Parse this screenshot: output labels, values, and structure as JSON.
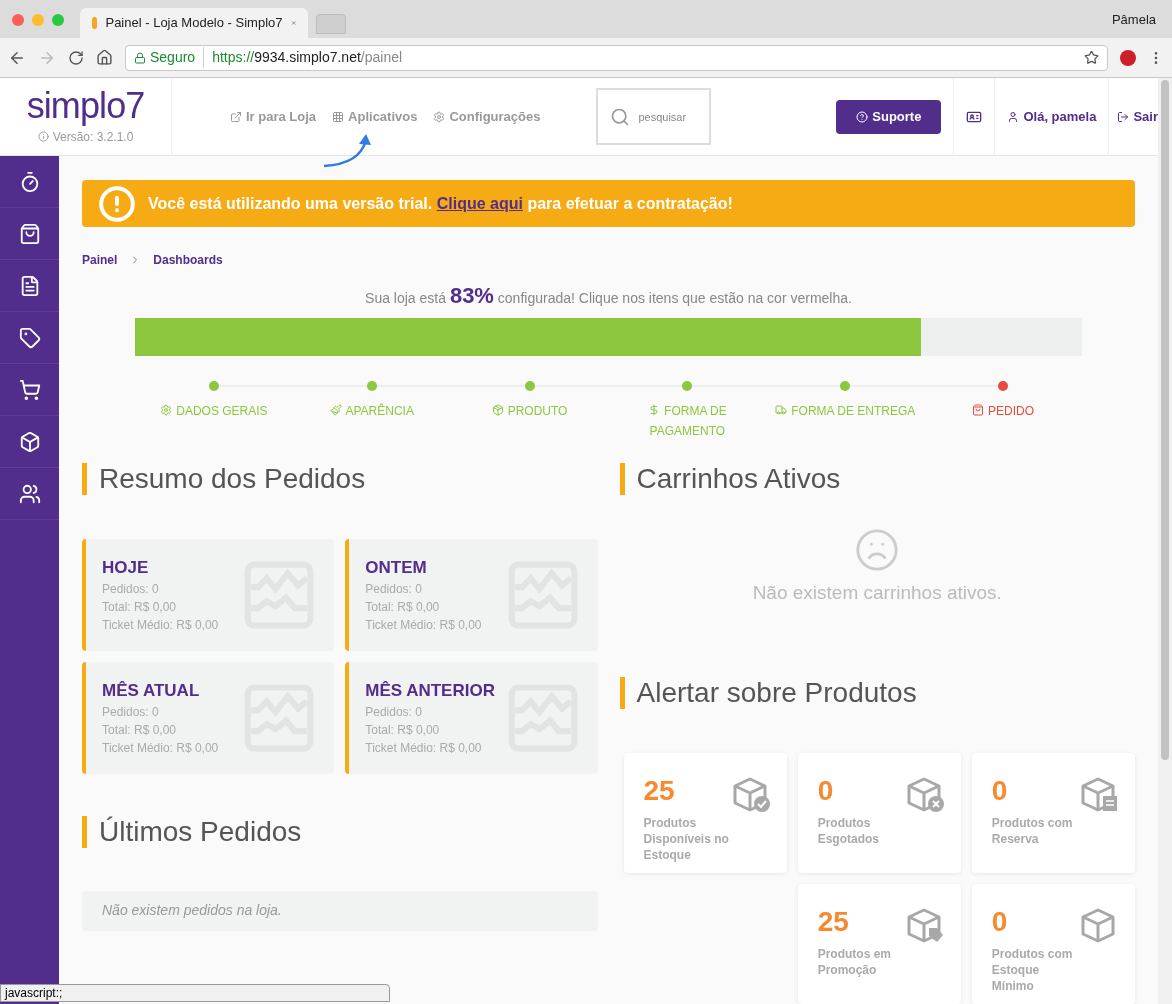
{
  "browser": {
    "tab_title": "Painel - Loja Modelo - Simplo7",
    "profile": "Pâmela",
    "security": "Seguro",
    "url_scheme": "https://",
    "url_host": "9934.simplo7.net",
    "url_path": "/painel",
    "status_text": "javascript:;"
  },
  "header": {
    "logo": "simplo7",
    "version": "Versão: 3.2.1.0",
    "nav": [
      {
        "label": "Ir para Loja"
      },
      {
        "label": "Aplicativos"
      },
      {
        "label": "Configurações"
      }
    ],
    "search": {
      "placeholder": "pesquisar"
    },
    "support": "Suporte",
    "user": "Olá, pamela",
    "logout": "Sair"
  },
  "banner": {
    "text": "Você está utilizando uma versão trial.",
    "link": "Clique aqui",
    "text_after": "para efetuar a contratação!"
  },
  "breadcrumb": [
    "Painel",
    "Dashboards"
  ],
  "progress": {
    "text_before": "Sua loja está",
    "percent": "83%",
    "text_after": "configurada! Clique nos itens que estão na cor vermelha.",
    "level": 0.83
  },
  "steps": [
    {
      "label": "DADOS GERAIS",
      "done": true
    },
    {
      "label": "APARÊNCIA",
      "done": true
    },
    {
      "label": "PRODUTO",
      "done": true
    },
    {
      "label": "FORMA DE PAGAMENTO",
      "done": true
    },
    {
      "label": "FORMA DE ENTREGA",
      "done": true
    },
    {
      "label": "PEDIDO",
      "done": false
    }
  ],
  "summary": {
    "title": "Resumo dos Pedidos",
    "cards": [
      {
        "title": "HOJE",
        "lines": [
          "Pedidos: 0",
          "Total: R$ 0,00",
          "Ticket Médio: R$ 0,00"
        ]
      },
      {
        "title": "ONTEM",
        "lines": [
          "Pedidos: 0",
          "Total: R$ 0,00",
          "Ticket Médio: R$ 0,00"
        ]
      },
      {
        "title": "MÊS ATUAL",
        "lines": [
          "Pedidos: 0",
          "Total: R$ 0,00",
          "Ticket Médio: R$ 0,00"
        ]
      },
      {
        "title": "MÊS ANTERIOR",
        "lines": [
          "Pedidos: 0",
          "Total: R$ 0,00",
          "Ticket Médio: R$ 0,00"
        ]
      }
    ]
  },
  "last_orders": {
    "title": "Últimos Pedidos",
    "empty": "Não existem pedidos na loja."
  },
  "carts": {
    "title": "Carrinhos Ativos",
    "empty": "Não existem carrinhos ativos."
  },
  "alerts": {
    "title": "Alertar sobre Produtos",
    "cards": [
      {
        "count": "25",
        "label": "Produtos Disponíveis no Estoque"
      },
      {
        "count": "0",
        "label": "Produtos Esgotados"
      },
      {
        "count": "0",
        "label": "Produtos com Reserva"
      },
      {
        "count": "25",
        "label": "Produtos em Promoção"
      },
      {
        "count": "0",
        "label": "Produtos com Estoque Mínimo"
      }
    ]
  }
}
